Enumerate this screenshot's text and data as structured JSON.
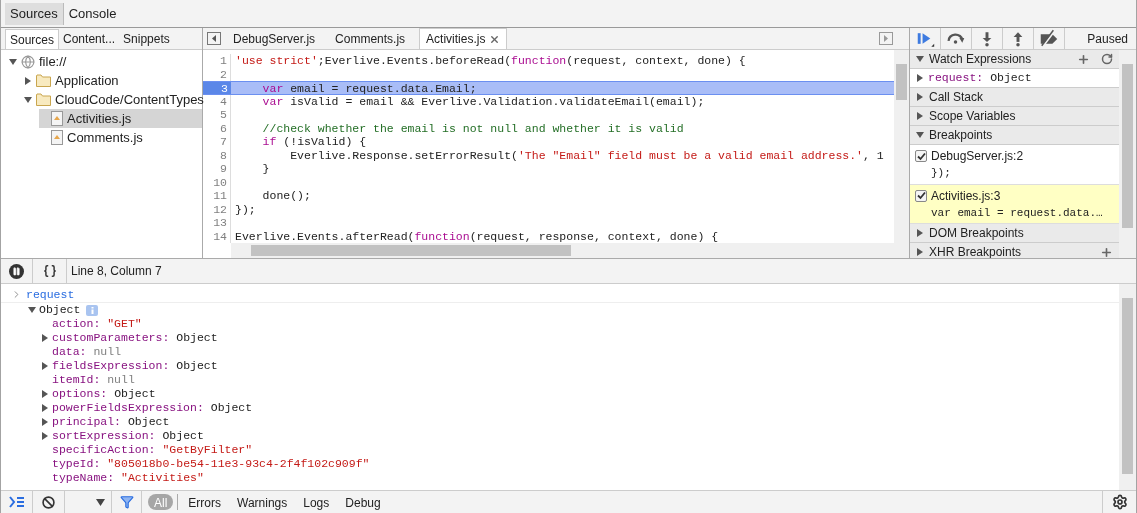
{
  "main_tabs": [
    {
      "label": "Sources",
      "selected": true
    },
    {
      "label": "Console",
      "selected": false
    }
  ],
  "navigator": {
    "tabs": [
      {
        "label": "Sources",
        "selected": true
      },
      {
        "label": "Content...",
        "selected": false
      },
      {
        "label": "Snippets",
        "selected": false
      }
    ],
    "tree": [
      {
        "label": "file://",
        "kind": "origin",
        "expanded": true,
        "selected": false,
        "children": [
          {
            "label": "Application",
            "kind": "folder",
            "expanded": false,
            "selected": false
          },
          {
            "label": "CloudCode/ContentTypes",
            "kind": "folder",
            "expanded": true,
            "selected": false,
            "children": [
              {
                "label": "Activities.js",
                "kind": "file",
                "selected": true
              },
              {
                "label": "Comments.js",
                "kind": "file",
                "selected": false
              }
            ]
          }
        ]
      }
    ]
  },
  "editor": {
    "tabs": [
      {
        "label": "DebugServer.js",
        "selected": false
      },
      {
        "label": "Comments.js",
        "selected": false
      },
      {
        "label": "Activities.js",
        "selected": true
      }
    ],
    "lines": [
      {
        "number": "1",
        "active": false,
        "tokens": [
          {
            "kind": "str",
            "text": "'use strict'"
          },
          {
            "kind": "plain",
            "text": ";Everlive.Events.beforeRead("
          },
          {
            "kind": "kw",
            "text": "function"
          },
          {
            "kind": "plain",
            "text": "(request, context, done) {"
          }
        ]
      },
      {
        "number": "2",
        "active": false
      },
      {
        "number": "3",
        "active": true,
        "tokens": [
          {
            "kind": "kw",
            "text": "    var"
          },
          {
            "kind": "plain",
            "text": " email = request.data.Email;"
          }
        ]
      },
      {
        "number": "4",
        "active": false,
        "tokens": [
          {
            "kind": "kw",
            "text": "    var"
          },
          {
            "kind": "plain",
            "text": " isValid = email && Everlive.Validation.validateEmail(email);"
          }
        ]
      },
      {
        "number": "5",
        "active": false
      },
      {
        "number": "6",
        "active": false,
        "tokens": [
          {
            "kind": "cm",
            "text": "    //check whether the email is not null and whether it is valid"
          }
        ]
      },
      {
        "number": "7",
        "active": false,
        "tokens": [
          {
            "kind": "kw",
            "text": "    if"
          },
          {
            "kind": "plain",
            "text": " (!isValid) {"
          }
        ]
      },
      {
        "number": "8",
        "active": false,
        "tokens": [
          {
            "kind": "plain",
            "text": "        Everlive.Response.setErrorResult("
          },
          {
            "kind": "str",
            "text": "'The \"Email\" field must be a valid email address.'"
          },
          {
            "kind": "plain",
            "text": ", 1"
          }
        ]
      },
      {
        "number": "9",
        "active": false,
        "tokens": [
          {
            "kind": "plain",
            "text": "    }"
          }
        ]
      },
      {
        "number": "10",
        "active": false
      },
      {
        "number": "11",
        "active": false,
        "tokens": [
          {
            "kind": "plain",
            "text": "    done();"
          }
        ]
      },
      {
        "number": "12",
        "active": false,
        "tokens": [
          {
            "kind": "plain",
            "text": "});"
          }
        ]
      },
      {
        "number": "13",
        "active": false
      },
      {
        "number": "14",
        "active": false,
        "tokens": [
          {
            "kind": "plain",
            "text": "Everlive.Events.afterRead("
          },
          {
            "kind": "kw",
            "text": "function"
          },
          {
            "kind": "plain",
            "text": "(request, response, context, done) {"
          }
        ]
      }
    ]
  },
  "debugger": {
    "status": "Paused",
    "sections": [
      {
        "title": "Watch Expressions",
        "expanded": true,
        "has_add": true,
        "has_refresh": true,
        "kind": "watch",
        "items": [
          {
            "name": "request:",
            "value": "Object",
            "expanded": false
          }
        ]
      },
      {
        "title": "Call Stack",
        "expanded": false,
        "has_add": false,
        "has_refresh": false
      },
      {
        "title": "Scope Variables",
        "expanded": false,
        "has_add": false,
        "has_refresh": false
      },
      {
        "title": "Breakpoints",
        "expanded": true,
        "has_add": false,
        "has_refresh": false,
        "kind": "breakpoints",
        "items": [
          {
            "file": "DebugServer.js:2",
            "code": "});",
            "checked": true,
            "selected": false
          },
          {
            "file": "Activities.js:3",
            "code": "var email = request.data.…",
            "checked": true,
            "selected": true
          }
        ]
      },
      {
        "title": "DOM Breakpoints",
        "expanded": false,
        "has_add": false,
        "has_refresh": false
      },
      {
        "title": "XHR Breakpoints",
        "expanded": false,
        "has_add": true,
        "has_refresh": false
      }
    ]
  },
  "status_bar": {
    "position": "Line 8, Column 7"
  },
  "console": {
    "input": "request",
    "object": {
      "label": "Object",
      "expanded": true,
      "properties": [
        {
          "key": "action:",
          "value": "\"GET\"",
          "kind": "string",
          "expandable": false
        },
        {
          "key": "customParameters:",
          "value": "Object",
          "kind": "object",
          "expandable": true
        },
        {
          "key": "data:",
          "value": "null",
          "kind": "null",
          "expandable": false
        },
        {
          "key": "fieldsExpression:",
          "value": "Object",
          "kind": "object",
          "expandable": true
        },
        {
          "key": "itemId:",
          "value": "null",
          "kind": "null",
          "expandable": false
        },
        {
          "key": "options:",
          "value": "Object",
          "kind": "object",
          "expandable": true
        },
        {
          "key": "powerFieldsExpression:",
          "value": "Object",
          "kind": "object",
          "expandable": true
        },
        {
          "key": "principal:",
          "value": "Object",
          "kind": "object",
          "expandable": true
        },
        {
          "key": "sortExpression:",
          "value": "Object",
          "kind": "object",
          "expandable": true
        },
        {
          "key": "specificAction:",
          "value": "\"GetByFilter\"",
          "kind": "string",
          "expandable": false
        },
        {
          "key": "typeId:",
          "value": "\"805018b0-be54-11e3-93c4-2f4f102c909f\"",
          "kind": "string",
          "expandable": false
        },
        {
          "key": "typeName:",
          "value": "\"Activities\"",
          "kind": "string",
          "expandable": false
        }
      ]
    }
  },
  "console_filters": [
    {
      "label": "All",
      "selected": true
    },
    {
      "label": "Errors",
      "selected": false
    },
    {
      "label": "Warnings",
      "selected": false
    },
    {
      "label": "Logs",
      "selected": false
    },
    {
      "label": "Debug",
      "selected": false
    }
  ]
}
